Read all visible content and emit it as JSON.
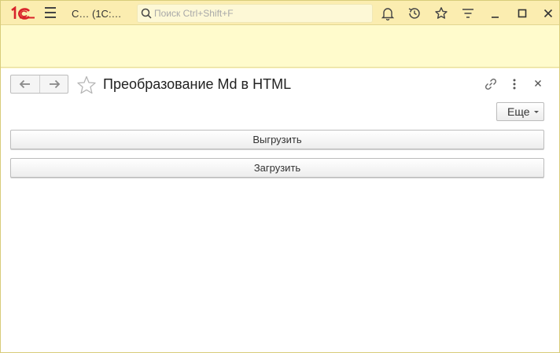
{
  "topbar": {
    "title": "С…   (1С:…",
    "search_placeholder": "Поиск Ctrl+Shift+F"
  },
  "form": {
    "title": "Преобразование Md в HTML",
    "more_label": "Еще",
    "export_label": "Выгрузить",
    "import_label": "Загрузить"
  },
  "colors": {
    "logo_red": "#d8232a",
    "topbar_bg": "#fbedb0",
    "strip_bg": "#fffbcc"
  },
  "icons": [
    "logo-1c-icon",
    "menu-icon",
    "search-icon",
    "bell-icon",
    "history-icon",
    "star-icon",
    "filter-icon",
    "minimize-icon",
    "maximize-icon",
    "close-icon",
    "back-arrow-icon",
    "forward-arrow-icon",
    "favorite-star-icon",
    "link-icon",
    "more-vertical-icon",
    "close-form-icon"
  ]
}
